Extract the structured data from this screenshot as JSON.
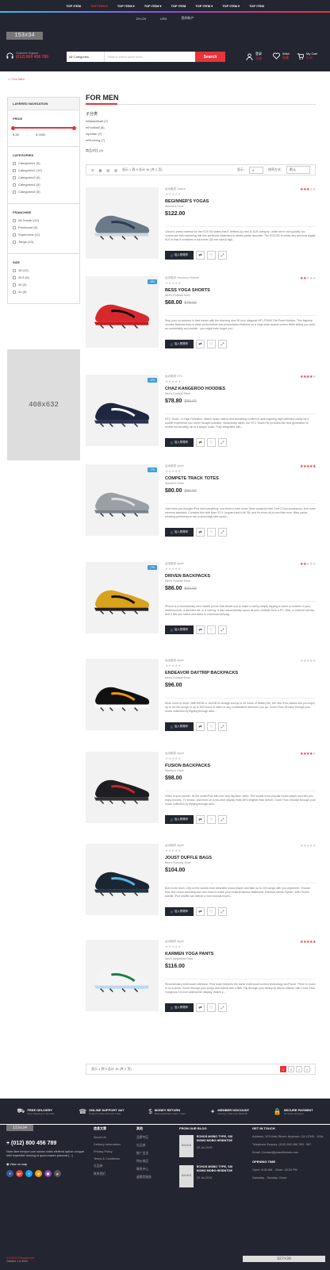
{
  "topnav": [
    "TOP ITEM",
    "TOP ITEM ▾",
    "TOP ITEM ▾",
    "TOP ITEM ▾",
    "TOP ITEM",
    "TOP ITEM ▾",
    "TOP ITEM ▾",
    "TOP ITEM"
  ],
  "langbar": {
    "lang": "ZH-CN",
    "currency": "USD",
    "account": "我的帐户"
  },
  "logo": "153x34",
  "support": {
    "label": "Customer Support",
    "phone": "(012) 800 456 789"
  },
  "search": {
    "category": "All Categories",
    "placeholder": "Search entire store here...",
    "button": "Search"
  },
  "header_links": {
    "login": "登录",
    "login_sub": "注册",
    "wishlist": "Wish",
    "wishlist_sub": "收藏",
    "cart": "My Cart",
    "cart_sub": "0.00"
  },
  "breadcrumb": {
    "current": "For Men"
  },
  "sidebar": {
    "title": "LAYERED NAVIGATION",
    "price": {
      "title": "PRICE",
      "min": "$ 55",
      "dash": "-",
      "max": "$ 2000"
    },
    "categories": {
      "title": "CATEGORIES",
      "items": [
        "Categories1 (5)",
        "Categories2 (10)",
        "Categories3 (5)",
        "Categories4 (5)",
        "Categories5 (5)"
      ]
    },
    "franchise": {
      "title": "FRANCHISE",
      "items": [
        "All Terrain (10)",
        "Pureboost (9)",
        "Supernova (11)",
        "Tango (10)"
      ]
    },
    "size": {
      "title": "SIZE",
      "items": [
        "38 (10)",
        "39.5 (5)",
        "40 (2)",
        "41 (5)"
      ]
    },
    "banner": "408x632"
  },
  "main": {
    "title": "FOR MEN",
    "subcat_heading": "子分类",
    "subcats": [
      "mBasketball (7)",
      "mFootball (8)",
      "mjordan (7)",
      "mRunning (7)"
    ],
    "compare": "商品对比 (0)",
    "toolbar": {
      "info": "显示 1 到 9 总计 16 (共 2 页)",
      "show_label": "显示:",
      "show_value": "9",
      "sort_label": "排序方式:",
      "sort_value": "默认"
    },
    "cart_btn": "加入购物车",
    "products": [
      {
        "cat": "运动鞋类 Casual",
        "name": "BEGINNER'S YOGAS",
        "sub": "Women's Shoe",
        "price": "$122.00",
        "old": "",
        "disc": "",
        "stars": 3,
        "desc": "Canon's press material for the EOS 5D states that it 'defines (a) new D-SLR category', while we're not typically too concerned with marketing talk this particular statement is clearly pretty accurate. The EOS 5D is unlike any previous digital SLR in that it combines a full-frame (35 mm sized) high..."
      },
      {
        "cat": "运动鞋类 Havaiana Pelewel",
        "name": "BESS YOGA SHORTS",
        "sub": "Men's Football Shoe",
        "price": "$68.00",
        "old": "$78.00",
        "disc": "-8%",
        "stars": 2,
        "desc": "Stop your co-workers in their tracks with the stunning new 30-inch diagonal HP LP3065 Flat Panel Monitor. This flagship monitor features best-in-class performance and presentation features on a huge wide-aspect screen while letting you work as comfortably as possible - you might even forget you'..."
      },
      {
        "cat": "运动鞋类 HTC",
        "name": "CHAZ KANGEROO HOODIES",
        "sub": "Men's Football Shoe",
        "price": "$78.80",
        "old": "$80.00",
        "disc": "-2%",
        "stars": 4,
        "desc": "HTC Touch - in High Definition. Watch music videos and streaming content in awe-inspiring high definition clarity for a mobile experience you never thought possible. Seductively sleek, the HTC Touch HD provides the next generation of mobile functionality, all at a simple touch. Fully integrated with..."
      },
      {
        "cat": "运动鞋类 Apple",
        "name": "COMPETE TRACK TOTES",
        "sub": "Women's Shoe",
        "price": "$80.00",
        "old": "$86.00",
        "disc": "-7%",
        "stars": 5,
        "desc": "Just when you thought iPod had everything, now there's even more. More powerful Intel Core 2 Duo processors. And more memory standard. Combine this with Mac OS X Leopard and iLife '08, and it's more all-in-one than ever. iMac packs amazing performance into a stunningly slim space..."
      },
      {
        "cat": "运动鞋类 Apple",
        "name": "DRIVEN BACKPACKS",
        "sub": "Men's Football Shoe",
        "price": "$86.00",
        "old": "$92.00",
        "disc": "-7%",
        "stars": 2,
        "desc": "iPhone is a revolutionary new mobile phone that allows you to make a call by simply tapping a name or number in your address book, a favorites list, or a call log. It also automatically syncs all your contacts from a PC, Mac, or Internet service. And it lets you select and listen to voicemail messag..."
      },
      {
        "cat": "运动鞋类 Apple",
        "name": "ENDEAVOR DAYTRIP BACKPACKS",
        "sub": "Men's Football Shoe",
        "price": "$96.00",
        "old": "",
        "disc": "",
        "stars": 0,
        "desc": "More room to move. With 80GB or 160GB of storage and up to 40 hours of battery life, the new iPod classic lets you enjoy up to 40,000 songs or up to 200 hours of video or any combination wherever you go. Cover Flow. Browse through your music collection by flipping through albu..."
      },
      {
        "cat": "运动鞋类 Apple",
        "name": "FUSION BACKPACKS",
        "sub": "Women's Shoe",
        "price": "$98.00",
        "old": "",
        "disc": "",
        "stars": 4,
        "desc": "Video in your pocket. Its the small iPod with one very big idea: video. The worlds most popular music player now lets you enjoy movies, TV shows, and more on a two-inch display thats 65% brighter than before. Cover Flow. Browse through your music collection by flipping through albu..."
      },
      {
        "cat": "运动鞋类 Apple",
        "name": "JOUST DUFFLE BAGS",
        "sub": "Men's Running Shoe",
        "price": "$104.00",
        "old": "",
        "disc": "",
        "stars": 0,
        "desc": "Born to be worn. Clip on the worlds most wearable music player and take up to 240 songs with you anywhere. Choose from five colors including four new hues to make your musical fashion statement. Random meets rhythm. With iTunes autofill, iPod shuffle can deliver a new musical experi..."
      },
      {
        "cat": "运动鞋类 Apple",
        "name": "KARMEN YOGA PANTS",
        "sub": "Men's Basketball Shoe",
        "price": "$116.00",
        "old": "",
        "disc": "",
        "stars": 5,
        "desc": "Revolutionary multi-touch interface. iPod touch features the same multi-touch screen technology as iPhone. Pinch to zoom in on a photo. Scroll through your songs and videos with a flick. Flip through your library by album artwork with Cover Flow. Gorgeous 3.5-inch widescreen display. Watch y..."
      }
    ],
    "pager": {
      "info": "显示 1 到 9 总计 16 (共 2 页)",
      "pages": [
        "1",
        "2",
        ">",
        "»"
      ]
    }
  },
  "services": [
    {
      "icon": "truck",
      "t1": "FREE DELIVERY",
      "t2": "Free shipping on all order"
    },
    {
      "icon": "headset",
      "t1": "ONLINE SUPPORT 24/7",
      "t2": "Support online 24 hours a day"
    },
    {
      "icon": "money",
      "t1": "MONEY RETURN",
      "t2": "Back guarantee under 7 days"
    },
    {
      "icon": "gift",
      "t1": "MEMBER DISCOUNT",
      "t2": "Onevery order over $120.00"
    },
    {
      "icon": "lock",
      "t1": "SECURE PAYMENT",
      "t2": "All cards accepted"
    }
  ],
  "footer": {
    "logo": "153x34",
    "phone": "+ (012) 800 456 789",
    "about": "Nam liber tempor cum soluta nobis eleifend option congue nihil imperdiet doming id quod mazim placerat [...]",
    "map": "View on map",
    "social_colors": [
      "#3b5998",
      "#dd4b39",
      "#1da1f2",
      "#ff9800",
      "#8e44ad",
      "#555555"
    ],
    "col1": {
      "title": "信息文章",
      "items": [
        "About Us",
        "Delivery Information",
        "Privacy Policy",
        "Terms & Conditions",
        "礼品券",
        "联系我们"
      ]
    },
    "col2": {
      "title": "其他",
      "items": [
        "品牌专区",
        "礼品券",
        "推广会员",
        "特价商品",
        "联系中心",
        "退换货服务"
      ]
    },
    "blog": {
      "title": "FROM OUR BLOG",
      "items": [
        {
          "img": "58x58",
          "title": "ECHOS MOBO TYPE, SIX NOMO MOBO HEIDNTOE",
          "date": "20 Jul 2019"
        },
        {
          "img": "58x58",
          "title": "ECHOS MOBO TYPE, SIX NOMO MOBO HEIDNTOE",
          "date": "20 Jul 2019"
        }
      ]
    },
    "contact": {
      "title": "GET IN TOUCH",
      "address": "Address: 123 Main Street, Anytown, CA 12345 - USA.",
      "phone": "Telephone Enquiry: (012) 800 456 789 - 987",
      "email": "Email: Contact@plazathemes.com",
      "hours_title": "OPENING TIME",
      "hours": "Open: 8:00 AM - Close: 18:00 PM",
      "hours2": "Saturday - Sunday: Close"
    },
    "copyright": "© 8:2019 Plazathemes",
    "copyright2": "October 1.9 2020",
    "payment": "327x30"
  }
}
